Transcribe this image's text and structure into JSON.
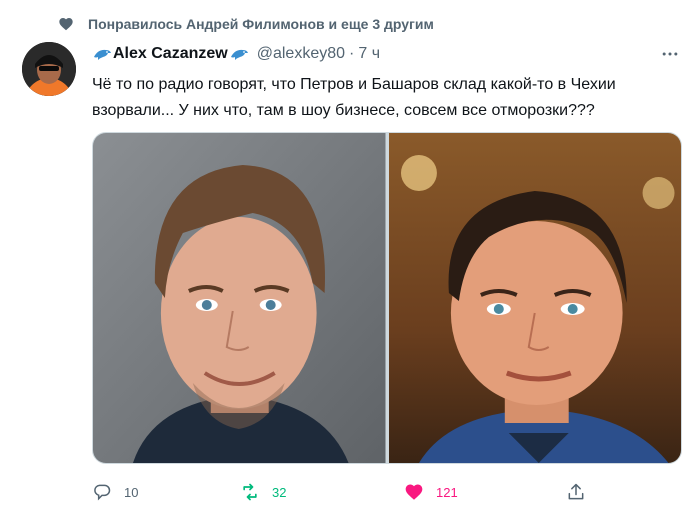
{
  "social_context": {
    "text": "Понравилось Андрей Филимонов и еще 3 другим",
    "icon": "heart-icon"
  },
  "author": {
    "display_name": "Alex Cazanzew",
    "handle": "@alexkey80",
    "separator": "·",
    "time": "7 ч",
    "badge_icon": "dolphin-emoji-icon"
  },
  "more_icon": "more-icon",
  "tweet": {
    "text": "Чё то по радио говорят, что Петров и Башаров склад какой-то в Чехии взорвали... У них что, там в шоу бизнесе, совсем все отморозки???"
  },
  "media": {
    "count": 2,
    "photos": [
      "photo-left",
      "photo-right"
    ]
  },
  "actions": {
    "reply_count": "10",
    "retweet_count": "32",
    "like_count": "121",
    "retweeted": true,
    "liked": true
  },
  "colors": {
    "text": "#0f1419",
    "secondary": "#536471",
    "retweet": "#00ba7c",
    "like": "#f91880",
    "context_heart": "#536471"
  }
}
